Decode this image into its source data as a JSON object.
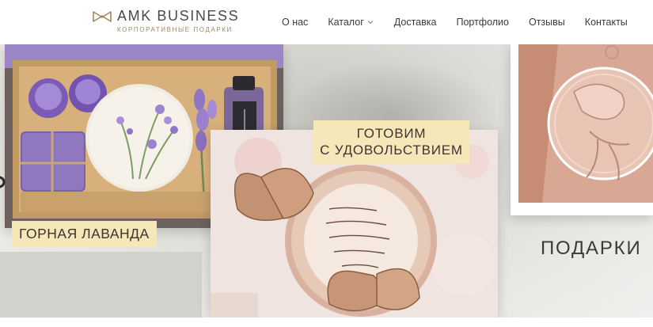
{
  "brand": {
    "name": "AMK BUSINESS",
    "tagline": "КОРПОРАТИВНЫЕ ПОДАРКИ",
    "logo_icon": "bow-tie-icon"
  },
  "nav": {
    "items": [
      {
        "label": "О нас"
      },
      {
        "label": "Каталог",
        "icon": "chevron-down-icon"
      },
      {
        "label": "Доставка"
      },
      {
        "label": "Портфолио"
      },
      {
        "label": "Отзывы"
      },
      {
        "label": "Контакты"
      }
    ]
  },
  "hero": {
    "captions": {
      "left": "ГОРНАЯ ЛАВАНДА",
      "center_line1": "ГОТОВИМ",
      "center_line2": "С УДОВОЛЬСТВИЕМ",
      "right": "ПОДАРКИ"
    },
    "photos": {
      "left": "lavender gift box photo",
      "center": "wooden butterfly card photo",
      "right": "wooden bird ornament photo"
    }
  },
  "colors": {
    "accent_gold": "#a2865c",
    "caption_bg": "#f6e7b9",
    "lavender": "#8e76b8"
  }
}
